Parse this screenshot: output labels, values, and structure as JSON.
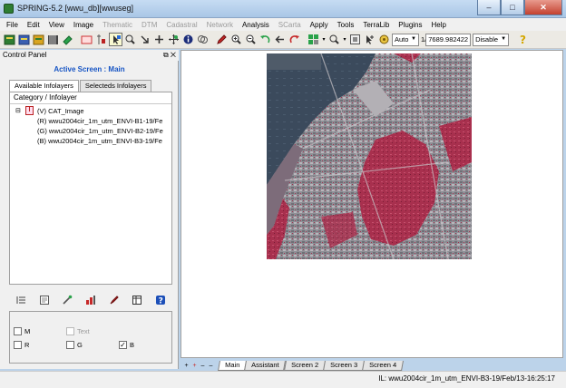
{
  "window": {
    "title": "SPRING-5.2 [wwu_db][wwuseg]",
    "min_label": "–",
    "max_label": "□",
    "close_label": "✕"
  },
  "menubar": {
    "items": [
      {
        "label": "File",
        "enabled": true
      },
      {
        "label": "Edit",
        "enabled": true
      },
      {
        "label": "View",
        "enabled": true
      },
      {
        "label": "Image",
        "enabled": true
      },
      {
        "label": "Thematic",
        "enabled": false
      },
      {
        "label": "DTM",
        "enabled": false
      },
      {
        "label": "Cadastral",
        "enabled": false
      },
      {
        "label": "Network",
        "enabled": false
      },
      {
        "label": "Analysis",
        "enabled": true
      },
      {
        "label": "SCarta",
        "enabled": false
      },
      {
        "label": "Apply",
        "enabled": true
      },
      {
        "label": "Tools",
        "enabled": true
      },
      {
        "label": "TerraLib",
        "enabled": true
      },
      {
        "label": "Plugins",
        "enabled": true
      },
      {
        "label": "Help",
        "enabled": true
      }
    ]
  },
  "toolbar": {
    "zoom_mode": "Auto",
    "scale_prefix": "1/",
    "scale_value": "7689.982422",
    "snap_mode": "Disable",
    "icons": [
      "open-database-icon",
      "open-project-icon",
      "open-infolayer-icon",
      "grid-icon",
      "eraser-icon",
      "screen-icon",
      "cursor-icon",
      "selected-tool-icon",
      "zoom-icon",
      "arrow-down-icon",
      "add-icon",
      "pan-icon",
      "info-icon",
      "layers-icon",
      "pencil-icon",
      "zoom-in-icon",
      "zoom-out-icon",
      "undo-icon",
      "back-icon",
      "redo-icon",
      "grid-color-icon",
      "zoom-options-icon",
      "frame-icon",
      "pointer-icon",
      "settings-icon",
      "help-icon"
    ]
  },
  "control_panel": {
    "title": "Control Panel",
    "float_label": "⧉",
    "close_label": "✕",
    "active_screen": "Active Screen : Main",
    "tabs": [
      "Available Infolayers",
      "Selecteds Infolayers"
    ],
    "tree_header": "Category / Infolayer",
    "category": {
      "expander": "⊟",
      "icon_letter": "I",
      "label": "(V) CAT_Image"
    },
    "layers": [
      {
        "label": "(R) wwu2004cir_1m_utm_ENVI-B1-19/Fe"
      },
      {
        "label": "(G) wwu2004cir_1m_utm_ENVI-B2-19/Fe"
      },
      {
        "label": "(B) wwu2004cir_1m_utm_ENVI-B3-19/Fe"
      }
    ],
    "checkboxes": [
      {
        "label": "M",
        "checked": false,
        "enabled": true
      },
      {
        "label": "Text",
        "checked": false,
        "enabled": false
      },
      {
        "label": "R",
        "checked": false,
        "enabled": true
      },
      {
        "label": "G",
        "checked": false,
        "enabled": true
      },
      {
        "label": "B",
        "checked": true,
        "enabled": true
      }
    ]
  },
  "screen_tabs": {
    "controls": [
      "+",
      "+",
      "–",
      "–"
    ],
    "tabs": [
      "Main",
      "Assistant",
      "Screen 2",
      "Screen 3",
      "Screen 4"
    ],
    "active": "Main"
  },
  "status": {
    "text": "IL: wwu2004cir_1m_utm_ENVI-B3-19/Feb/13-16:25:17"
  },
  "colors": {
    "accent": "#1654c4",
    "vegetation": "#b0304f",
    "water": "#2d3f52"
  }
}
